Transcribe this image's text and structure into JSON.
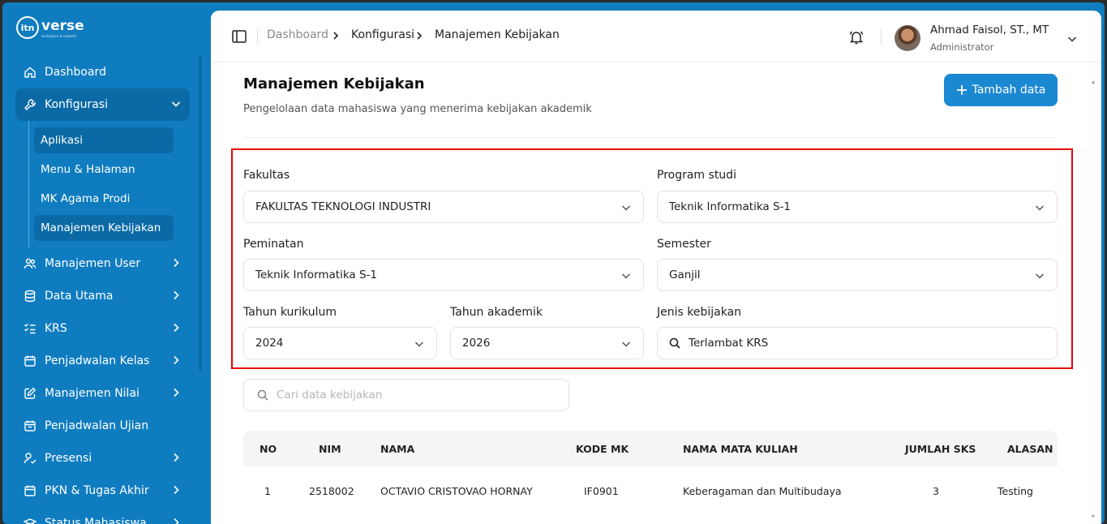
{
  "brand": {
    "mark": "itn",
    "name": "verse",
    "tagline": "workspace & network"
  },
  "sidebar": {
    "items": [
      {
        "label": "Dashboard",
        "icon": "home-icon"
      },
      {
        "label": "Konfigurasi",
        "icon": "wrench-icon"
      },
      {
        "label": "Manajemen User",
        "icon": "users-icon"
      },
      {
        "label": "Data Utama",
        "icon": "database-icon"
      },
      {
        "label": "KRS",
        "icon": "list-check-icon"
      },
      {
        "label": "Penjadwalan Kelas",
        "icon": "calendar-icon"
      },
      {
        "label": "Manajemen Nilai",
        "icon": "edit-icon"
      },
      {
        "label": "Penjadwalan Ujian",
        "icon": "calendar-icon"
      },
      {
        "label": "Presensi",
        "icon": "user-check-icon"
      },
      {
        "label": "PKN & Tugas Akhir",
        "icon": "calendar-icon"
      },
      {
        "label": "Status Mahasiswa",
        "icon": "graduation-icon"
      }
    ],
    "submenu": [
      "Aplikasi",
      "Menu & Halaman",
      "MK Agama Prodi",
      "Manajemen Kebijakan"
    ]
  },
  "header": {
    "breadcrumb": [
      "Dashboard",
      "Konfigurasi",
      "Manajemen Kebijakan"
    ],
    "user_name": "Ahmad Faisol, ST., MT",
    "user_role": "Administrator"
  },
  "page": {
    "title": "Manajemen Kebijakan",
    "subtitle": "Pengelolaan data mahasiswa yang menerima kebijakan akademik",
    "add_button": "Tambah data"
  },
  "filters": {
    "fakultas": {
      "label": "Fakultas",
      "value": "FAKULTAS TEKNOLOGI INDUSTRI"
    },
    "prodi": {
      "label": "Program studi",
      "value": "Teknik Informatika S-1"
    },
    "peminatan": {
      "label": "Peminatan",
      "value": "Teknik Informatika S-1"
    },
    "semester": {
      "label": "Semester",
      "value": "Ganjil"
    },
    "kurikulum": {
      "label": "Tahun kurikulum",
      "value": "2024"
    },
    "akademik": {
      "label": "Tahun akademik",
      "value": "2026"
    },
    "jenis": {
      "label": "Jenis kebijakan",
      "value": "Terlambat KRS"
    }
  },
  "search": {
    "placeholder": "Cari data kebijakan"
  },
  "table": {
    "headers": [
      "NO",
      "NIM",
      "NAMA",
      "KODE MK",
      "NAMA MATA KULIAH",
      "JUMLAH SKS",
      "ALASAN"
    ],
    "rows": [
      [
        "1",
        "2518002",
        "OCTAVIO CRISTOVAO HORNAY",
        "IF0901",
        "Keberagaman dan Multibudaya",
        "3",
        "Testing"
      ]
    ]
  },
  "colors": {
    "primary": "#0f7cc0",
    "accent": "#1b88d2",
    "highlight_border": "#ee0000"
  }
}
